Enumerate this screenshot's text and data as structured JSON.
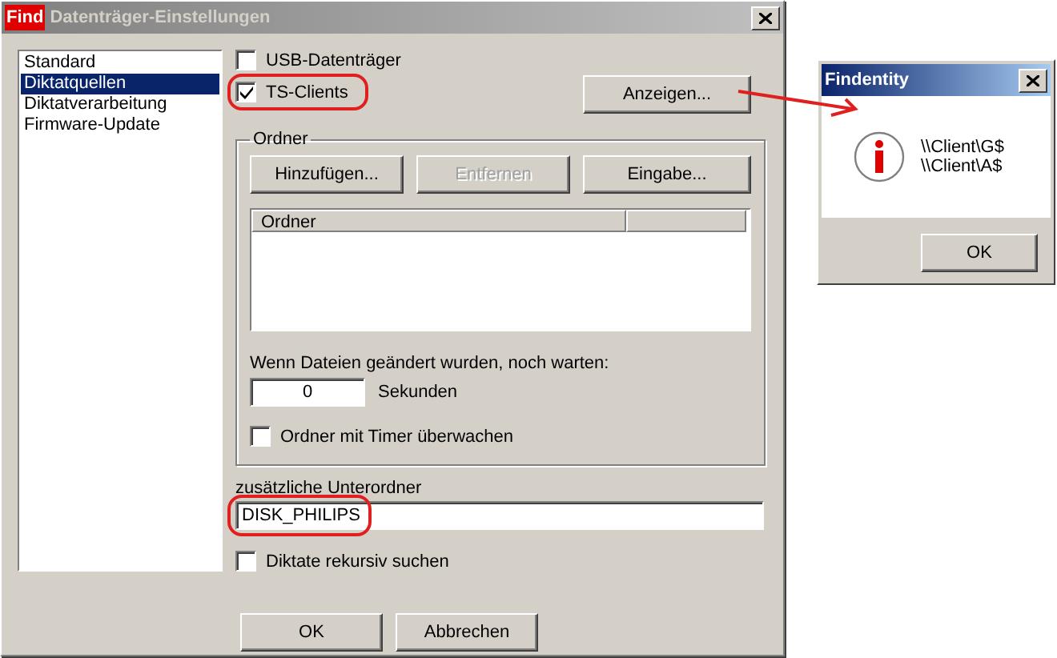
{
  "dialog": {
    "badge": "Find",
    "title": "Datenträger-Einstellungen"
  },
  "nav": [
    {
      "label": "Standard",
      "selected": false
    },
    {
      "label": "Diktatquellen",
      "selected": true
    },
    {
      "label": "Diktatverarbeitung",
      "selected": false
    },
    {
      "label": "Firmware-Update",
      "selected": false
    }
  ],
  "sources": [
    {
      "label": "USB-Datenträger",
      "checked": false
    },
    {
      "label": "TS-Clients",
      "checked": true
    }
  ],
  "show_button": "Anzeigen...",
  "folders": {
    "title": "Ordner",
    "buttons": [
      {
        "label": "Hinzufügen...",
        "disabled": false
      },
      {
        "label": "Entfernen",
        "disabled": true
      },
      {
        "label": "Eingabe...",
        "disabled": false
      }
    ],
    "columns": [
      "Ordner"
    ],
    "wait_label": "Wenn Dateien geändert wurden, noch warten:",
    "wait_value": "0",
    "wait_unit": "Sekunden",
    "timer": {
      "label": "Ordner mit Timer überwachen",
      "checked": false
    }
  },
  "subfolder": {
    "label": "zusätzliche Unterordner",
    "value": "DISK_PHILIPS"
  },
  "recursive": {
    "label": "Diktate rekursiv suchen",
    "checked": false
  },
  "buttons": [
    "OK",
    "Abbrechen"
  ],
  "popup": {
    "title": "Findentity",
    "lines": [
      "\\\\Client\\G$",
      "\\\\Client\\A$"
    ],
    "button": "OK"
  }
}
